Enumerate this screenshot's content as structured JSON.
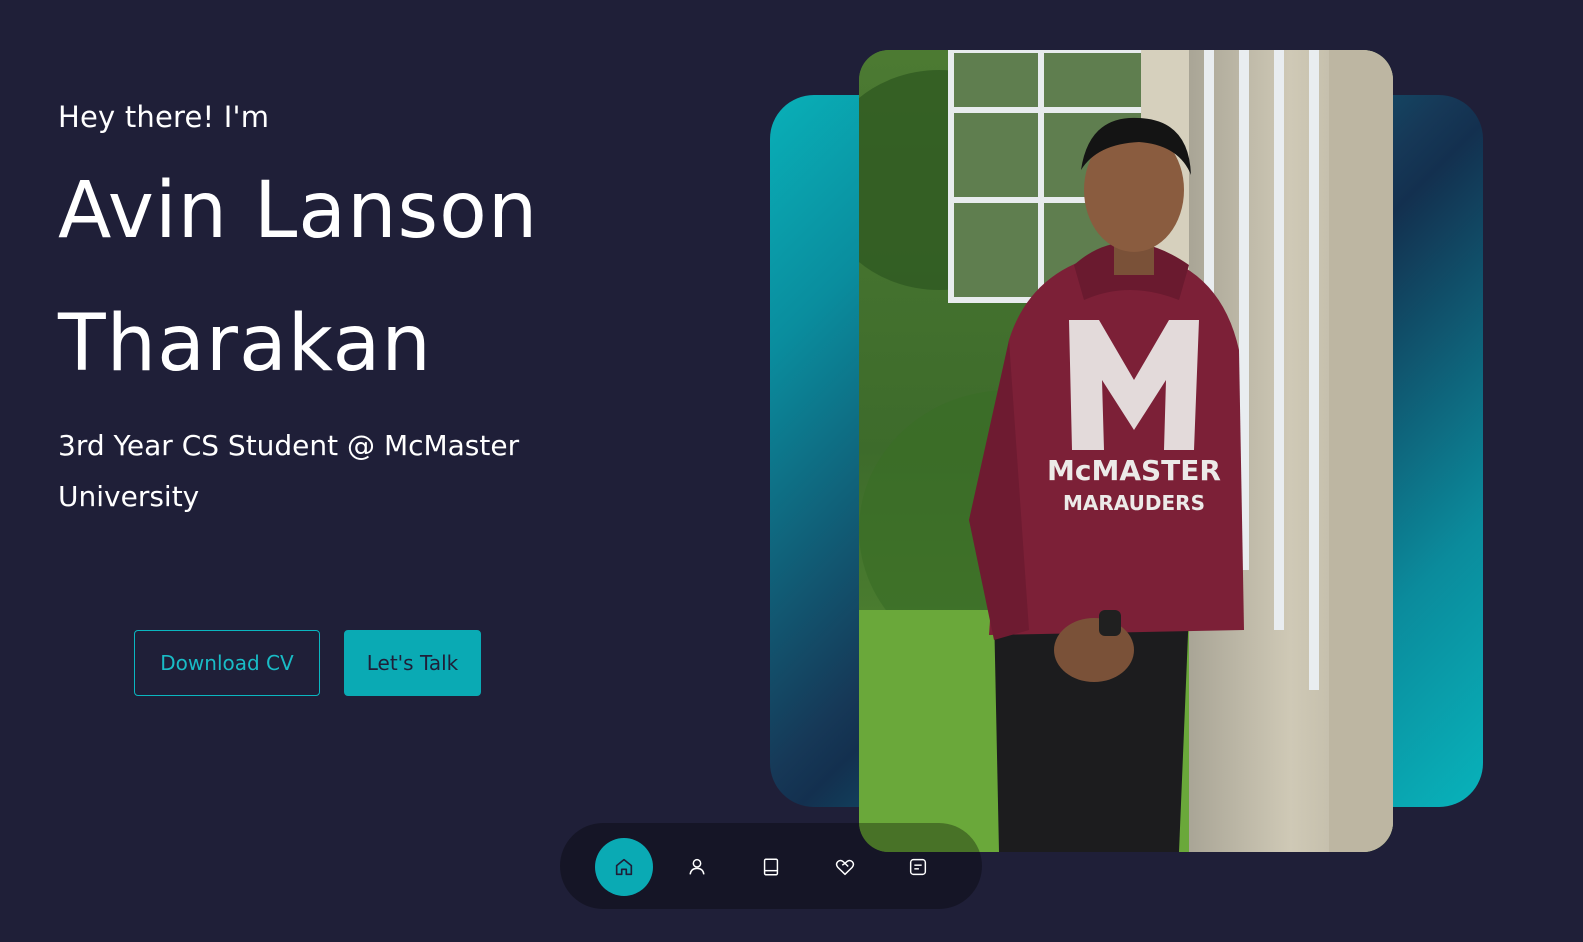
{
  "hero": {
    "greeting": "Hey there! I'm",
    "name_line_1": "Avin Lanson",
    "name_line_2": "Tharakan",
    "role": "3rd Year CS Student @ McMaster University"
  },
  "buttons": {
    "download_cv": "Download CV",
    "lets_talk": "Let's Talk"
  },
  "photo": {
    "hoodie_line_1": "McMASTER",
    "hoodie_line_2": "MARAUDERS"
  },
  "nav": {
    "items": [
      {
        "icon": "home-icon",
        "active": true
      },
      {
        "icon": "user-icon",
        "active": false
      },
      {
        "icon": "book-icon",
        "active": false
      },
      {
        "icon": "handshake-heart-icon",
        "active": false
      },
      {
        "icon": "message-icon",
        "active": false
      }
    ]
  },
  "colors": {
    "background": "#1f1f38",
    "accent": "#0aaab4",
    "text": "#ffffff"
  }
}
